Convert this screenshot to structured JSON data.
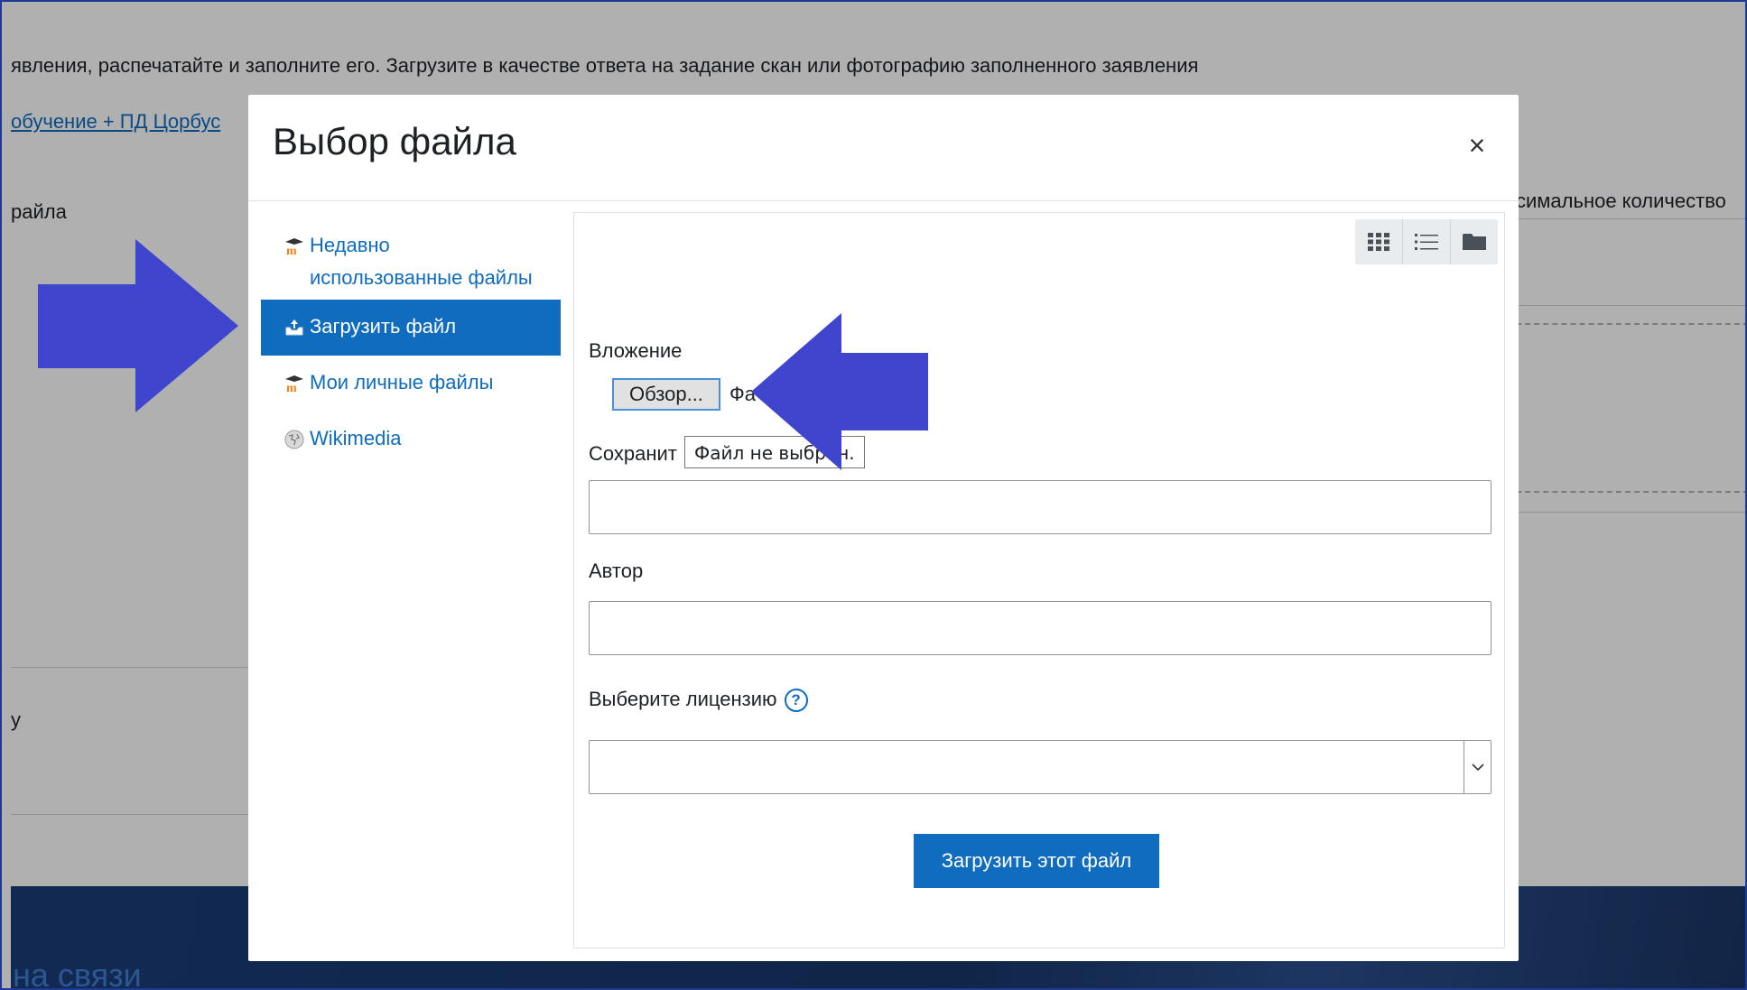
{
  "background": {
    "instruction_text": "явления, распечатайте и заполните его. Загрузите в качестве ответа на задание скан или фотографию заполненного заявления",
    "link_text": " обучение + ПД Цорбус",
    "file_label": "райла",
    "max_count_text": "симальное количество",
    "small_char": "у",
    "footer_text": "на связи"
  },
  "modal": {
    "title": "Выбор файла",
    "close_label": "×"
  },
  "side_nav": {
    "items": [
      {
        "label": "Недавно использованные файлы",
        "icon": "moodle-icon",
        "active": false
      },
      {
        "label": "Загрузить файл",
        "icon": "upload-icon",
        "active": true
      },
      {
        "label": "Мои личные файлы",
        "icon": "moodle-icon",
        "active": false
      },
      {
        "label": "Wikimedia",
        "icon": "wikimedia-icon",
        "active": false
      }
    ]
  },
  "panel": {
    "view_buttons": [
      "grid-view-icon",
      "list-view-icon",
      "folder-view-icon"
    ],
    "attachment_label": "Вложение",
    "browse_label": "Обзор...",
    "file_status": "Фа",
    "tooltip_text": "Файл не выбран.",
    "save_as_label": "Сохранит",
    "save_as_value": "",
    "author_label": "Автор",
    "author_value": "",
    "license_label": "Выберите лицензию",
    "license_help": "?",
    "license_value": "",
    "upload_button_label": "Загрузить этот файл"
  },
  "colors": {
    "accent": "#0f6cbf",
    "arrow": "#3f45cc",
    "footer": "#1b3d78"
  }
}
